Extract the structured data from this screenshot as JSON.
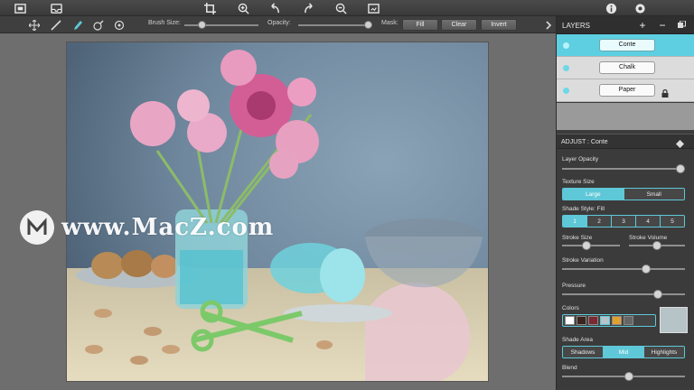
{
  "top_toolbar": {
    "buttons": [
      "frame-icon",
      "inbox-icon",
      "crop-icon",
      "zoom-in-icon",
      "undo-icon",
      "redo-icon",
      "zoom-out-icon",
      "export-icon",
      "info-icon",
      "settings-icon"
    ]
  },
  "brush_bar": {
    "tools": [
      "move-icon",
      "brush-icon",
      "smudge-icon",
      "eraser-icon",
      "stamp-icon"
    ],
    "brush_size_label": "Brush Size:",
    "opacity_label": "Opacity:",
    "mask_label": "Mask:",
    "fill_label": "Fill",
    "clear_label": "Clear",
    "invert_label": "Invert",
    "brush_size_value": 0.2,
    "opacity_value": 1.0
  },
  "watermark": {
    "text": "www.MacZ.com"
  },
  "layers": {
    "title": "LAYERS",
    "add_label": "+",
    "remove_label": "−",
    "items": [
      {
        "name": "Conte",
        "selected": true,
        "locked": false
      },
      {
        "name": "Chalk",
        "selected": false,
        "locked": false
      },
      {
        "name": "Paper",
        "selected": false,
        "locked": true
      }
    ]
  },
  "adjust": {
    "title": "ADJUST : Conte",
    "layer_opacity_label": "Layer Opacity",
    "layer_opacity_value": 1.0,
    "texture_size_label": "Texture Size",
    "texture_size_options": [
      "Large",
      "Small"
    ],
    "texture_size_selected": "Large",
    "shade_style_label": "Shade Style: Fill",
    "shade_style_options": [
      "1",
      "2",
      "3",
      "4",
      "5"
    ],
    "shade_style_selected": "1",
    "stroke_size_label": "Stroke Size",
    "stroke_size_value": 0.4,
    "stroke_volume_label": "Stroke Volume",
    "stroke_volume_value": 0.5,
    "stroke_variation_label": "Stroke Variation",
    "stroke_variation_value": 0.7,
    "pressure_label": "Pressure",
    "pressure_value": 0.8,
    "colors_label": "Colors",
    "color_swatches": [
      "#ffffff",
      "#3a2520",
      "#7a2a30",
      "#b6c3c7",
      "#e0a030",
      "#666666"
    ],
    "selected_color": "#b6c3c7",
    "shade_area_label": "Shade Area",
    "shade_area_options": [
      "Shadows",
      "Mid",
      "Highlights"
    ],
    "shade_area_selected": "Mid",
    "blend_label": "Blend",
    "blend_value": 0.55
  },
  "colors": {
    "accent": "#5fc8d8",
    "panel_bg": "#3b3b3b",
    "canvas_bg": "#6e6e6e"
  }
}
